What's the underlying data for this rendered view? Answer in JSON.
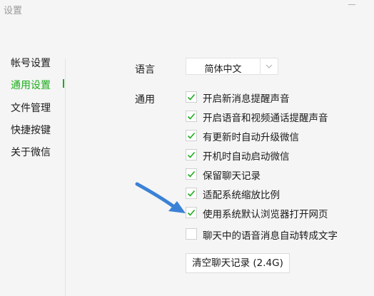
{
  "window": {
    "title": "设置"
  },
  "sidebar": {
    "items": [
      {
        "label": "帐号设置",
        "active": false
      },
      {
        "label": "通用设置",
        "active": true
      },
      {
        "label": "文件管理",
        "active": false
      },
      {
        "label": "快捷按键",
        "active": false
      },
      {
        "label": "关于微信",
        "active": false
      }
    ]
  },
  "language": {
    "label": "语言",
    "selected": "简体中文",
    "arrow_icon": "chevron-down-icon"
  },
  "general": {
    "label": "通用",
    "options": [
      {
        "label": "开启新消息提醒声音",
        "checked": true
      },
      {
        "label": "开启语音和视频通话提醒声音",
        "checked": true
      },
      {
        "label": "有更新时自动升级微信",
        "checked": true
      },
      {
        "label": "开机时自动启动微信",
        "checked": true
      },
      {
        "label": "保留聊天记录",
        "checked": true
      },
      {
        "label": "适配系统缩放比例",
        "checked": true
      },
      {
        "label": "使用系统默认浏览器打开网页",
        "checked": true
      },
      {
        "label": "聊天中的语音消息自动转成文字",
        "checked": false
      }
    ],
    "clear_button": "清空聊天记录 (2.4G)"
  },
  "colors": {
    "accent": "#1aad19",
    "annotation_arrow": "#3b82d6"
  }
}
